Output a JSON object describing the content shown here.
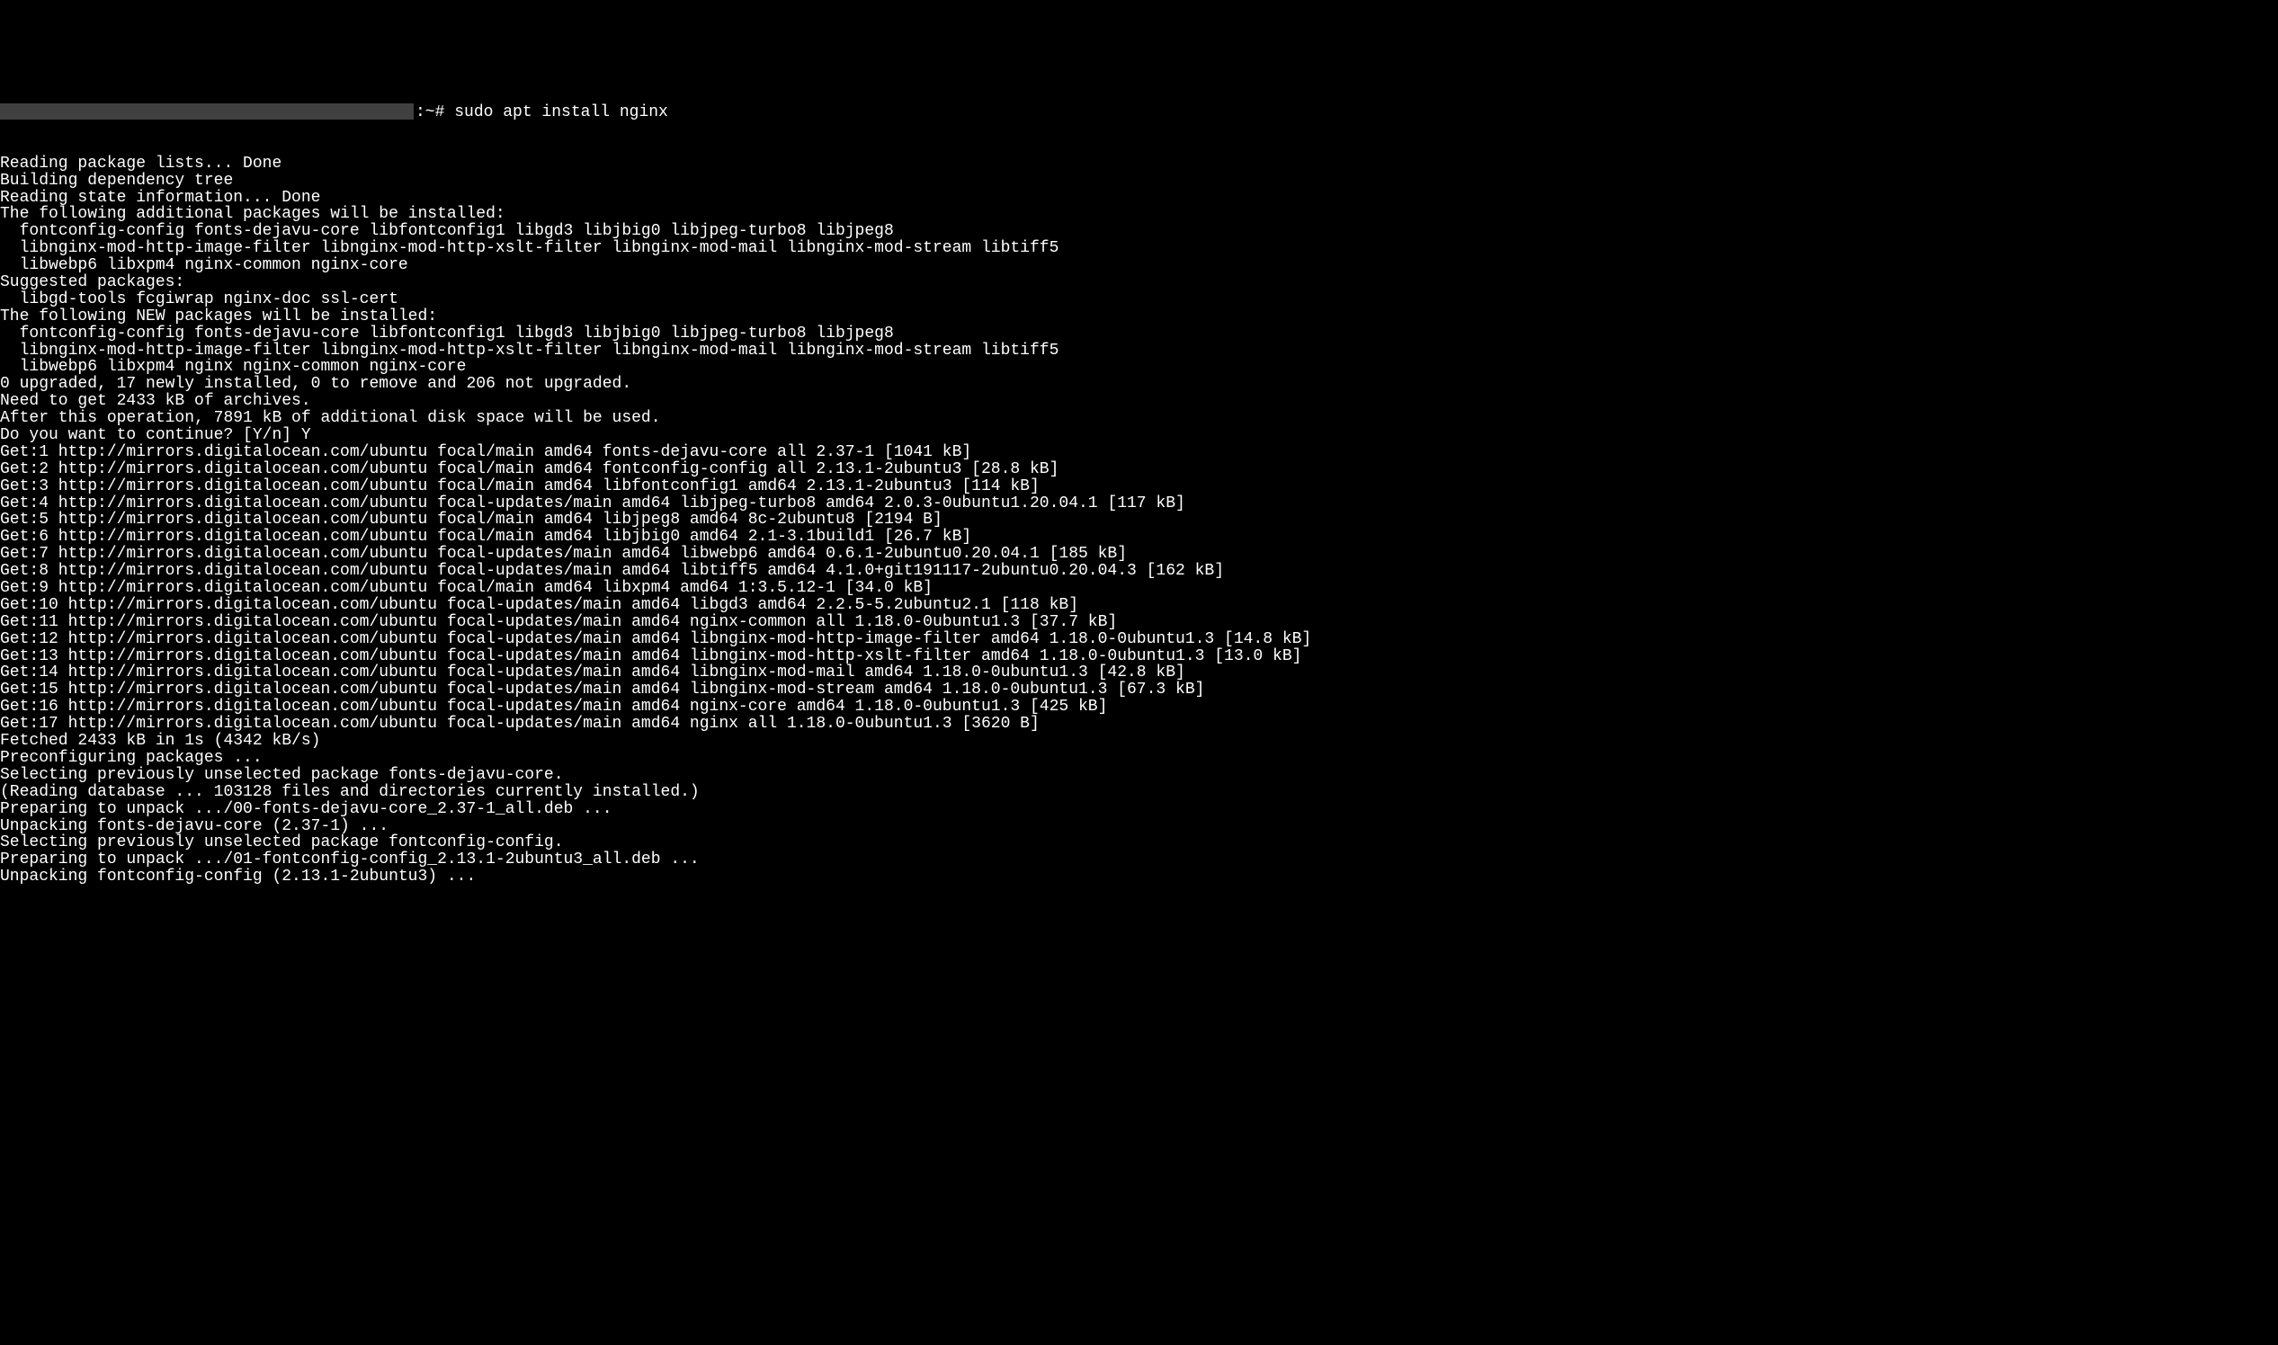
{
  "prompt": {
    "suffix": ":~# ",
    "command": "sudo apt install nginx"
  },
  "lines": [
    "Reading package lists... Done",
    "Building dependency tree",
    "Reading state information... Done",
    "The following additional packages will be installed:",
    "  fontconfig-config fonts-dejavu-core libfontconfig1 libgd3 libjbig0 libjpeg-turbo8 libjpeg8",
    "  libnginx-mod-http-image-filter libnginx-mod-http-xslt-filter libnginx-mod-mail libnginx-mod-stream libtiff5",
    "  libwebp6 libxpm4 nginx-common nginx-core",
    "Suggested packages:",
    "  libgd-tools fcgiwrap nginx-doc ssl-cert",
    "The following NEW packages will be installed:",
    "  fontconfig-config fonts-dejavu-core libfontconfig1 libgd3 libjbig0 libjpeg-turbo8 libjpeg8",
    "  libnginx-mod-http-image-filter libnginx-mod-http-xslt-filter libnginx-mod-mail libnginx-mod-stream libtiff5",
    "  libwebp6 libxpm4 nginx nginx-common nginx-core",
    "0 upgraded, 17 newly installed, 0 to remove and 206 not upgraded.",
    "Need to get 2433 kB of archives.",
    "After this operation, 7891 kB of additional disk space will be used.",
    "Do you want to continue? [Y/n] Y",
    "Get:1 http://mirrors.digitalocean.com/ubuntu focal/main amd64 fonts-dejavu-core all 2.37-1 [1041 kB]",
    "Get:2 http://mirrors.digitalocean.com/ubuntu focal/main amd64 fontconfig-config all 2.13.1-2ubuntu3 [28.8 kB]",
    "Get:3 http://mirrors.digitalocean.com/ubuntu focal/main amd64 libfontconfig1 amd64 2.13.1-2ubuntu3 [114 kB]",
    "Get:4 http://mirrors.digitalocean.com/ubuntu focal-updates/main amd64 libjpeg-turbo8 amd64 2.0.3-0ubuntu1.20.04.1 [117 kB]",
    "Get:5 http://mirrors.digitalocean.com/ubuntu focal/main amd64 libjpeg8 amd64 8c-2ubuntu8 [2194 B]",
    "Get:6 http://mirrors.digitalocean.com/ubuntu focal/main amd64 libjbig0 amd64 2.1-3.1build1 [26.7 kB]",
    "Get:7 http://mirrors.digitalocean.com/ubuntu focal-updates/main amd64 libwebp6 amd64 0.6.1-2ubuntu0.20.04.1 [185 kB]",
    "Get:8 http://mirrors.digitalocean.com/ubuntu focal-updates/main amd64 libtiff5 amd64 4.1.0+git191117-2ubuntu0.20.04.3 [162 kB]",
    "Get:9 http://mirrors.digitalocean.com/ubuntu focal/main amd64 libxpm4 amd64 1:3.5.12-1 [34.0 kB]",
    "Get:10 http://mirrors.digitalocean.com/ubuntu focal-updates/main amd64 libgd3 amd64 2.2.5-5.2ubuntu2.1 [118 kB]",
    "Get:11 http://mirrors.digitalocean.com/ubuntu focal-updates/main amd64 nginx-common all 1.18.0-0ubuntu1.3 [37.7 kB]",
    "Get:12 http://mirrors.digitalocean.com/ubuntu focal-updates/main amd64 libnginx-mod-http-image-filter amd64 1.18.0-0ubuntu1.3 [14.8 kB]",
    "Get:13 http://mirrors.digitalocean.com/ubuntu focal-updates/main amd64 libnginx-mod-http-xslt-filter amd64 1.18.0-0ubuntu1.3 [13.0 kB]",
    "Get:14 http://mirrors.digitalocean.com/ubuntu focal-updates/main amd64 libnginx-mod-mail amd64 1.18.0-0ubuntu1.3 [42.8 kB]",
    "Get:15 http://mirrors.digitalocean.com/ubuntu focal-updates/main amd64 libnginx-mod-stream amd64 1.18.0-0ubuntu1.3 [67.3 kB]",
    "Get:16 http://mirrors.digitalocean.com/ubuntu focal-updates/main amd64 nginx-core amd64 1.18.0-0ubuntu1.3 [425 kB]",
    "Get:17 http://mirrors.digitalocean.com/ubuntu focal-updates/main amd64 nginx all 1.18.0-0ubuntu1.3 [3620 B]",
    "Fetched 2433 kB in 1s (4342 kB/s)",
    "Preconfiguring packages ...",
    "Selecting previously unselected package fonts-dejavu-core.",
    "(Reading database ... 103128 files and directories currently installed.)",
    "Preparing to unpack .../00-fonts-dejavu-core_2.37-1_all.deb ...",
    "Unpacking fonts-dejavu-core (2.37-1) ...",
    "Selecting previously unselected package fontconfig-config.",
    "Preparing to unpack .../01-fontconfig-config_2.13.1-2ubuntu3_all.deb ...",
    "Unpacking fontconfig-config (2.13.1-2ubuntu3) ..."
  ]
}
